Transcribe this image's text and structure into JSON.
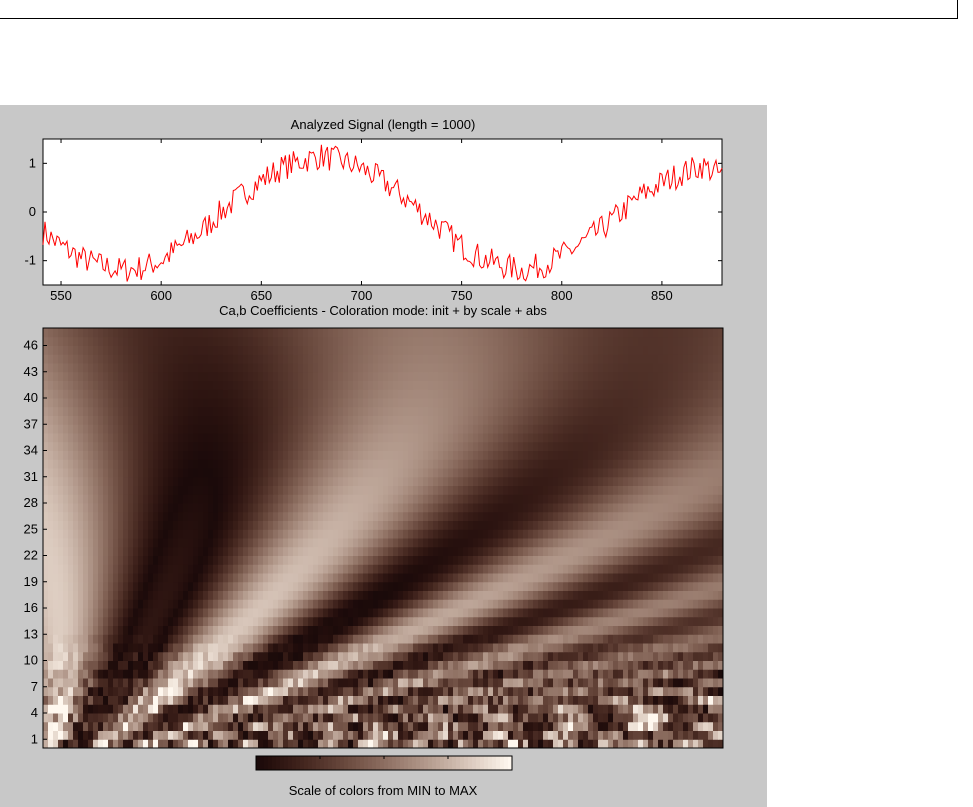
{
  "chart_data": [
    {
      "type": "line",
      "title": "Analyzed Signal (length = 1000)",
      "xlim": [
        541,
        880
      ],
      "ylim": [
        -1.5,
        1.5
      ],
      "x_ticks": [
        "550",
        "600",
        "650",
        "700",
        "750",
        "800",
        "850"
      ],
      "y_ticks": [
        "-1",
        "0",
        "1"
      ],
      "series": [
        {
          "color": "#ff0000",
          "x": [
            541,
            550,
            560,
            570,
            580,
            590,
            600,
            610,
            620,
            630,
            640,
            650,
            660,
            670,
            680,
            690,
            700,
            710,
            720,
            730,
            740,
            750,
            760,
            770,
            780,
            790,
            800,
            810,
            820,
            830,
            840,
            850,
            860,
            870,
            880
          ],
          "y": [
            -0.4,
            -0.7,
            -0.95,
            -1.1,
            -1.2,
            -1.15,
            -1.0,
            -0.7,
            -0.4,
            0.0,
            0.35,
            0.65,
            0.9,
            1.05,
            1.15,
            1.05,
            0.9,
            0.65,
            0.35,
            0.0,
            -0.35,
            -0.7,
            -0.95,
            -1.1,
            -1.2,
            -1.1,
            -0.9,
            -0.65,
            -0.35,
            0.0,
            0.35,
            0.6,
            0.8,
            0.95,
            0.75
          ]
        }
      ]
    },
    {
      "type": "heatmap",
      "title": "Ca,b Coefficients - Coloration mode: init + by scale + abs",
      "x_range": [
        541,
        880
      ],
      "y_ticks": [
        "1",
        "4",
        "7",
        "10",
        "13",
        "16",
        "19",
        "22",
        "25",
        "28",
        "31",
        "34",
        "37",
        "40",
        "43",
        "46"
      ],
      "ylim": [
        0,
        48
      ],
      "colormap": "pink"
    },
    {
      "type": "heatmap",
      "title": "Scale of colors from MIN to MAX",
      "colormap": "pink"
    }
  ],
  "colors": {
    "background": "#c8c8c8",
    "signal": "#ff0000",
    "map_dark": "#1a0a0a",
    "map_mid": "#9e6e6e",
    "map_light": "#fff8ef"
  }
}
